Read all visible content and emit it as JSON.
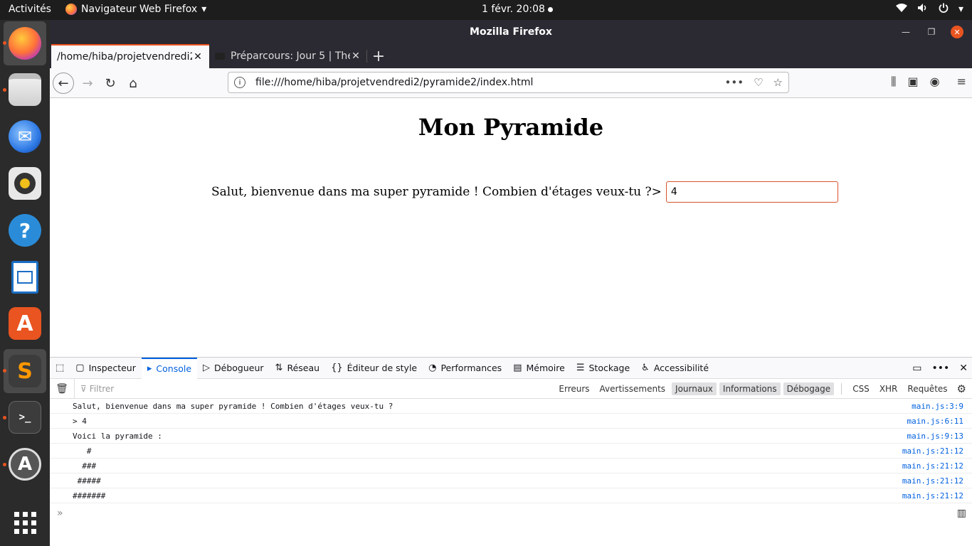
{
  "topbar": {
    "activities": "Activités",
    "app_menu": "Navigateur Web Firefox",
    "clock": "1 févr.  20:08",
    "tray_icons": [
      "wifi-icon",
      "volume-icon",
      "power-icon",
      "chevron-down-icon"
    ]
  },
  "dock": {
    "items": [
      {
        "name": "firefox",
        "icon": "firefox-icon",
        "color": "#ff7139"
      },
      {
        "name": "files",
        "icon": "folder-icon",
        "color": "#d6d6d6"
      },
      {
        "name": "thunderbird",
        "icon": "mail-icon",
        "color": "#2f7ae5"
      },
      {
        "name": "rhythmbox",
        "icon": "music-icon",
        "color": "#f2c01c"
      },
      {
        "name": "help",
        "icon": "help-icon",
        "color": "#2a8cd8"
      },
      {
        "name": "writer",
        "icon": "document-icon",
        "color": "#1b6fc5"
      },
      {
        "name": "software",
        "icon": "software-icon",
        "color": "#e95420"
      },
      {
        "name": "sublime",
        "icon": "sublime-icon",
        "color": "#ff9800"
      },
      {
        "name": "terminal",
        "icon": "terminal-icon",
        "color": "#3c3c3c"
      },
      {
        "name": "updater",
        "icon": "updater-icon",
        "color": "#555555"
      }
    ],
    "show_apps_icon": "grid-icon"
  },
  "window": {
    "title": "Mozilla Firefox",
    "tabs": [
      {
        "label": "/home/hiba/projetvendredi2",
        "selected": true
      },
      {
        "label": "Préparcours: Jour 5 | The",
        "selected": false
      }
    ],
    "url": "file:///home/hiba/projetvendredi2/pyramide2/index.html"
  },
  "page": {
    "heading": "Mon Pyramide",
    "prompt": "Salut, bienvenue dans ma super pyramide ! Combien d'étages veux-tu ?>",
    "input_value": "4"
  },
  "devtools": {
    "tabs": [
      {
        "label": "Inspecteur",
        "icon": "inspector-icon"
      },
      {
        "label": "Console",
        "icon": "console-icon",
        "active": true
      },
      {
        "label": "Débogueur",
        "icon": "debugger-icon"
      },
      {
        "label": "Réseau",
        "icon": "network-icon"
      },
      {
        "label": "Éditeur de style",
        "icon": "style-editor-icon"
      },
      {
        "label": "Performances",
        "icon": "performance-icon"
      },
      {
        "label": "Mémoire",
        "icon": "memory-icon"
      },
      {
        "label": "Stockage",
        "icon": "storage-icon"
      },
      {
        "label": "Accessibilité",
        "icon": "accessibility-icon"
      }
    ],
    "filter_placeholder": "Filtrer",
    "levels": [
      {
        "label": "Erreurs",
        "on": false
      },
      {
        "label": "Avertissements",
        "on": false
      },
      {
        "label": "Journaux",
        "on": true
      },
      {
        "label": "Informations",
        "on": true
      },
      {
        "label": "Débogage",
        "on": true
      }
    ],
    "extra_filters": [
      "CSS",
      "XHR",
      "Requêtes"
    ],
    "logs": [
      {
        "text": "Salut, bienvenue dans ma super pyramide ! Combien d'étages veux-tu ?",
        "src": "main.js:3:9"
      },
      {
        "text": "> 4",
        "src": "main.js:6:11"
      },
      {
        "text": "Voici la pyramide :",
        "src": "main.js:9:13"
      },
      {
        "text": "   #",
        "src": "main.js:21:12"
      },
      {
        "text": "  ###",
        "src": "main.js:21:12"
      },
      {
        "text": " #####",
        "src": "main.js:21:12"
      },
      {
        "text": "#######",
        "src": "main.js:21:12"
      }
    ],
    "input_prompt": "»"
  }
}
